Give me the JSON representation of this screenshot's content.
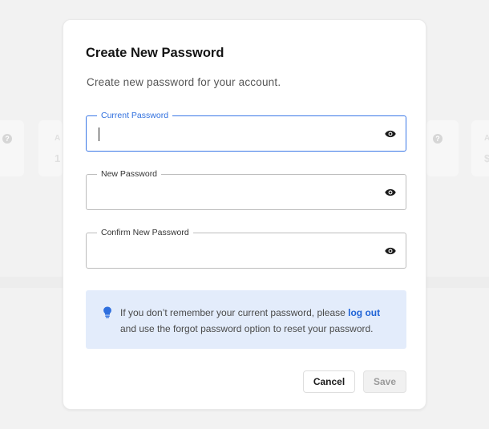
{
  "background": {
    "help_glyph": "?",
    "card_texts": [
      "A",
      "1",
      "A",
      "$"
    ]
  },
  "dialog": {
    "title": "Create New Password",
    "subtitle": "Create new password for your account.",
    "fields": [
      {
        "label": "Current Password",
        "value": "",
        "placeholder": "",
        "focused": true,
        "icon": "eye-icon"
      },
      {
        "label": "New Password",
        "value": "",
        "placeholder": "",
        "focused": false,
        "icon": "eye-icon"
      },
      {
        "label": "Confirm New Password",
        "value": "",
        "placeholder": "",
        "focused": false,
        "icon": "eye-icon"
      }
    ],
    "info": {
      "icon": "lightbulb-icon",
      "text_before": "If you don’t remember your current password, please ",
      "link": "log out",
      "text_after": " and use the forgot password option to reset your password."
    },
    "buttons": {
      "cancel": "Cancel",
      "save": "Save"
    }
  },
  "colors": {
    "accent": "#2f6fde",
    "info_bg": "#e3ecfb",
    "link": "#1f63d6"
  }
}
